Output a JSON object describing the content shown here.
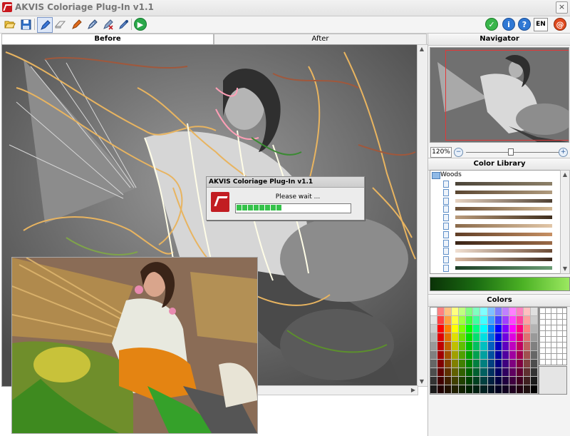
{
  "window": {
    "title": "AKVIS Coloriage Plug-In v1.1",
    "close_glyph": "×"
  },
  "toolbar": {
    "language": "EN",
    "icons": [
      "open-icon",
      "save-icon",
      "pencil-icon",
      "eraser-icon",
      "color-pencil-icon",
      "keep-pencil-icon",
      "cross-pencil-icon",
      "eyedropper-icon",
      "run-icon",
      "apply-icon",
      "info-icon",
      "help-icon",
      "language-button",
      "akvis-logo-icon"
    ]
  },
  "tabs": {
    "before": "Before",
    "after": "After"
  },
  "dialog": {
    "title": "AKVIS Coloriage Plug-In v1.1",
    "message": "Please wait ...",
    "progress_percent": 38
  },
  "panel": {
    "navigator_title": "Navigator",
    "zoom": "120%",
    "zoom_minus": "−",
    "zoom_plus": "+",
    "zoom_level_fraction": 0.47,
    "color_library_title": "Color Library",
    "folder_name": "Woods",
    "colors_title": "Colors"
  },
  "colors": {
    "accent_red": "#c8181e",
    "library_gradients": [
      [
        "#4b4438",
        "#8d8068"
      ],
      [
        "#5a4631",
        "#b09b7e"
      ],
      [
        "#e7d3c1",
        "#4e4032"
      ],
      [
        "#6b4f35",
        "#d0b692"
      ],
      [
        "#b99a7a",
        "#3f2e1d"
      ],
      [
        "#8a6a4a",
        "#e2c7a8"
      ],
      [
        "#603e26",
        "#c79063"
      ],
      [
        "#3a2416",
        "#9b6a47"
      ],
      [
        "#f1e0d2",
        "#6b4a34"
      ],
      [
        "#d8b8a0",
        "#3d2a1e"
      ],
      [
        "#1b3e25",
        "#6a9c74"
      ],
      [
        "#1d6b3b",
        "#8fc29b"
      ]
    ],
    "palette": [
      "#ffffff",
      "#ff8080",
      "#ffc080",
      "#ffff80",
      "#c0ff80",
      "#80ff80",
      "#80ffc0",
      "#80ffff",
      "#80c0ff",
      "#8080ff",
      "#c080ff",
      "#ff80ff",
      "#ff80c0",
      "#ffc0c0",
      "#e0e0e0",
      "#e6e6e6",
      "#ff4040",
      "#ffa040",
      "#ffff40",
      "#a0ff40",
      "#40ff40",
      "#40ffa0",
      "#40ffff",
      "#40a0ff",
      "#4040ff",
      "#a040ff",
      "#ff40ff",
      "#ff40a0",
      "#ffa0a0",
      "#cccccc",
      "#cccccc",
      "#ff0000",
      "#ff8000",
      "#ffff00",
      "#80ff00",
      "#00ff00",
      "#00ff80",
      "#00ffff",
      "#0080ff",
      "#0000ff",
      "#8000ff",
      "#ff00ff",
      "#ff0080",
      "#ff8080",
      "#b3b3b3",
      "#b3b3b3",
      "#e00000",
      "#e07000",
      "#e0e000",
      "#70e000",
      "#00e000",
      "#00e070",
      "#00e0e0",
      "#0070e0",
      "#0000e0",
      "#7000e0",
      "#e000e0",
      "#e00070",
      "#e07070",
      "#999999",
      "#999999",
      "#c00000",
      "#c06000",
      "#c0c000",
      "#60c000",
      "#00c000",
      "#00c060",
      "#00c0c0",
      "#0060c0",
      "#0000c0",
      "#6000c0",
      "#c000c0",
      "#c00060",
      "#c06060",
      "#808080",
      "#808080",
      "#a00000",
      "#a05000",
      "#a0a000",
      "#50a000",
      "#00a000",
      "#00a050",
      "#00a0a0",
      "#0050a0",
      "#0000a0",
      "#5000a0",
      "#a000a0",
      "#a00050",
      "#a05050",
      "#666666",
      "#666666",
      "#800000",
      "#804000",
      "#808000",
      "#408000",
      "#008000",
      "#008040",
      "#008080",
      "#004080",
      "#000080",
      "#400080",
      "#800080",
      "#800040",
      "#804040",
      "#4d4d4d",
      "#4d4d4d",
      "#600000",
      "#603000",
      "#606000",
      "#306000",
      "#006000",
      "#006030",
      "#006060",
      "#003060",
      "#000060",
      "#300060",
      "#600060",
      "#600030",
      "#603030",
      "#333333",
      "#333333",
      "#400000",
      "#402000",
      "#404000",
      "#204000",
      "#004000",
      "#004020",
      "#004040",
      "#002040",
      "#000040",
      "#200040",
      "#400040",
      "#400020",
      "#402020",
      "#1a1a1a",
      "#1a1a1a",
      "#200000",
      "#201000",
      "#202000",
      "#102000",
      "#002000",
      "#002010",
      "#002020",
      "#001020",
      "#000020",
      "#100020",
      "#200020",
      "#200010",
      "#201010",
      "#000000"
    ]
  }
}
